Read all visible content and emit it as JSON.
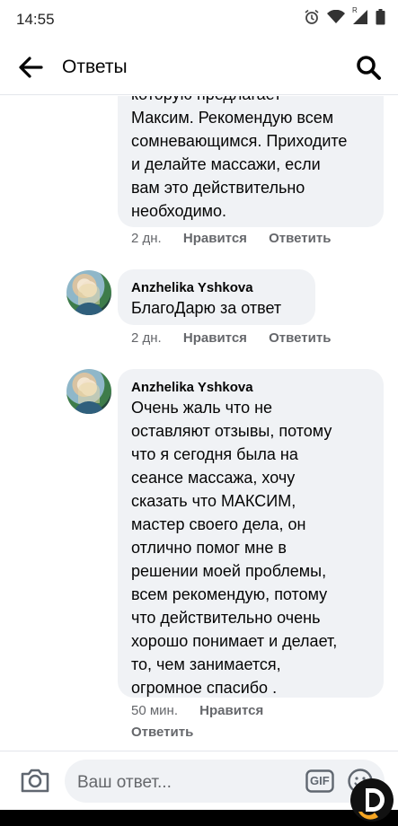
{
  "status_bar": {
    "time": "14:55",
    "network_label": "R"
  },
  "header": {
    "title": "Ответы",
    "back_icon": "arrow-left-icon",
    "search_icon": "search-icon"
  },
  "comments": [
    {
      "author": "",
      "lines": [
        "которую предлагает",
        "Максим. Рекомендую всем",
        "сомневающимся. Приходите",
        "и делайте массажи, если",
        "вам это действительно",
        "необходимо."
      ],
      "time": "2 дн.",
      "like_label": "Нравится",
      "reply_label": "Ответить"
    },
    {
      "author": "Anzhelika Yshkova",
      "lines": [
        "БлагоДарю за ответ"
      ],
      "time": "2 дн.",
      "like_label": "Нравится",
      "reply_label": "Ответить"
    },
    {
      "author": "Anzhelika Yshkova",
      "lines": [
        "Очень жаль что не",
        "оставляют отзывы, потому",
        "что я сегодня была на",
        "сеансе массажа, хочу",
        "сказать что МАКСИМ,",
        "мастер своего дела, он",
        "отлично помог мне в",
        "решении моей проблемы,",
        "всем рекомендую, потому",
        "что действительно очень",
        "хорошо понимает и делает,",
        "то, чем занимается,",
        "огромное спасибо ."
      ],
      "time": "50 мин.",
      "like_label": "Нравится",
      "reply_label": "Ответить"
    }
  ],
  "composer": {
    "placeholder": "Ваш ответ...",
    "camera_icon": "camera-icon",
    "gif_label": "GIF",
    "emoji_icon": "emoji-icon"
  },
  "colors": {
    "bubble": "#f0f2f5",
    "meta": "#65676b",
    "text": "#050505"
  }
}
